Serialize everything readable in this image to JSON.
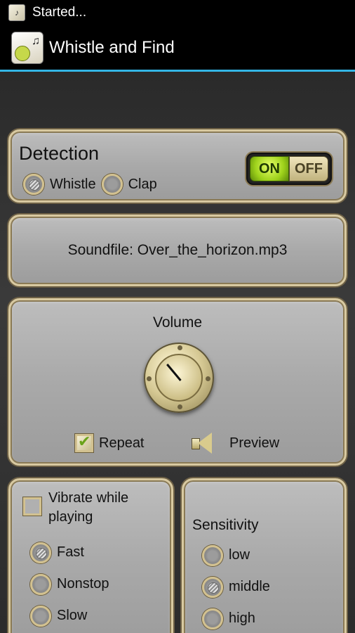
{
  "status_bar": {
    "notification_text": "Started..."
  },
  "action_bar": {
    "title": "Whistle and Find"
  },
  "detection": {
    "title": "Detection",
    "options": [
      {
        "label": "Whistle",
        "selected": true
      },
      {
        "label": "Clap",
        "selected": false
      }
    ],
    "toggle": {
      "on_label": "ON",
      "off_label": "OFF",
      "state": "ON"
    }
  },
  "soundfile": {
    "text": "Soundfile: Over_the_horizon.mp3"
  },
  "volume": {
    "title": "Volume",
    "repeat": {
      "label": "Repeat",
      "checked": true
    },
    "preview": {
      "label": "Preview"
    }
  },
  "vibrate": {
    "label": "Vibrate while playing",
    "checked": false,
    "options": [
      {
        "label": "Fast",
        "selected": true
      },
      {
        "label": "Nonstop",
        "selected": false
      },
      {
        "label": "Slow",
        "selected": false
      }
    ]
  },
  "sensitivity": {
    "title": "Sensitivity",
    "options": [
      {
        "label": "low",
        "selected": false
      },
      {
        "label": "middle",
        "selected": true
      },
      {
        "label": "high",
        "selected": false
      }
    ]
  },
  "colors": {
    "accent": "#33b5e5",
    "panel_border": "#d8c9a0",
    "toggle_on": "#9ed21b"
  }
}
